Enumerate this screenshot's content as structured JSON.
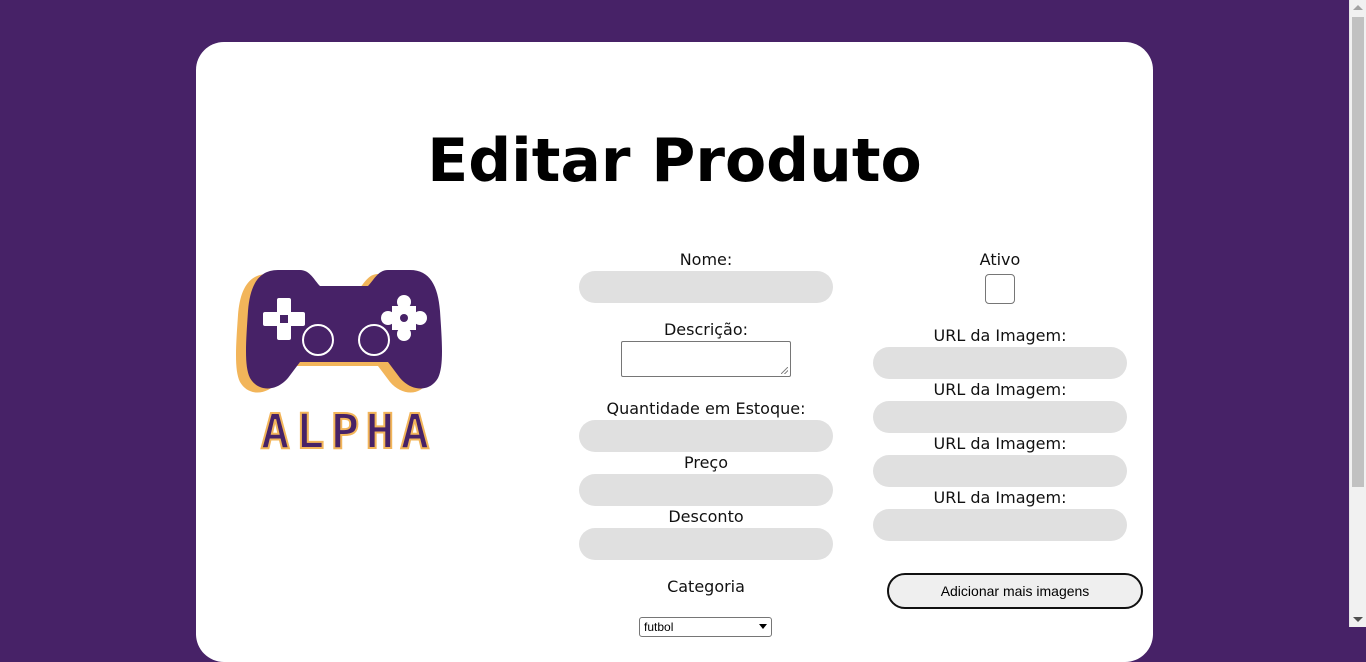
{
  "page": {
    "title": "Editar Produto"
  },
  "brand": {
    "logo_text": "ALPHA",
    "colors": {
      "purple": "#472267",
      "orange": "#f2b55a",
      "background": "#472267"
    }
  },
  "form": {
    "nome_label": "Nome:",
    "nome_value": "",
    "descricao_label": "Descrição:",
    "descricao_value": "",
    "estoque_label": "Quantidade em Estoque:",
    "estoque_value": "",
    "preco_label": "Preço",
    "preco_value": "",
    "desconto_label": "Desconto",
    "desconto_value": "",
    "categoria_label": "Categoria",
    "categoria_value": "futbol",
    "ativo_label": "Ativo",
    "ativo_checked": false,
    "imagens": [
      {
        "label": "URL da Imagem:",
        "value": ""
      },
      {
        "label": "URL da Imagem:",
        "value": ""
      },
      {
        "label": "URL da Imagem:",
        "value": ""
      },
      {
        "label": "URL da Imagem:",
        "value": ""
      }
    ],
    "add_images_button": "Adicionar mais imagens"
  }
}
